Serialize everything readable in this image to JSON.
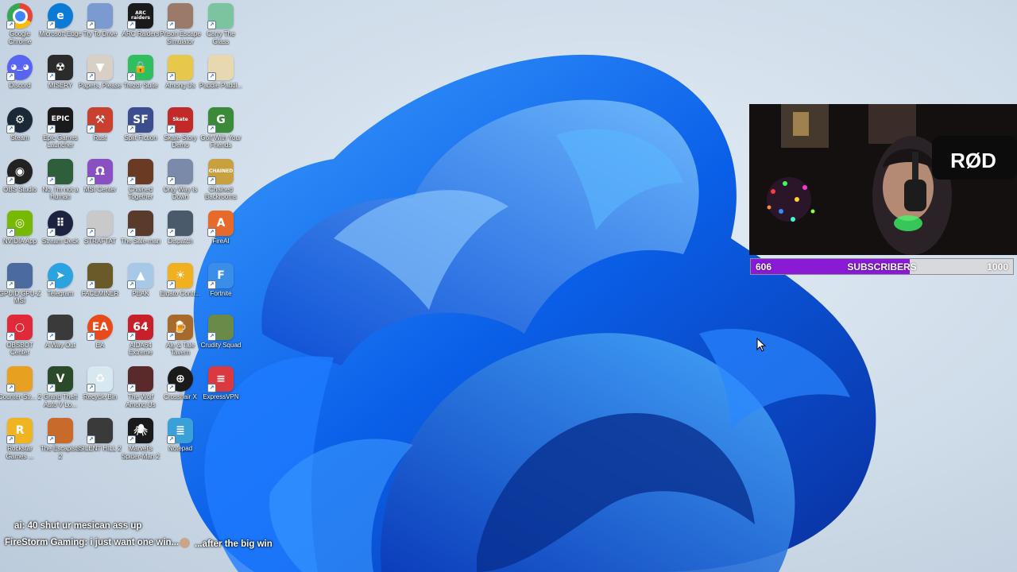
{
  "desktop": {
    "icons": [
      {
        "label": "Google Chrome",
        "color": "#ffffff",
        "glyph": "chrome-icon",
        "text": "",
        "round": true
      },
      {
        "label": "Microsoft Edge",
        "color": "#0c7bd6",
        "glyph": "edge-icon",
        "text": "e",
        "round": true
      },
      {
        "label": "Try To Drive",
        "color": "#7a9ad0",
        "glyph": "game-icon",
        "text": ""
      },
      {
        "label": "ARC Raiders",
        "color": "#1a1a1a",
        "glyph": "arc-raiders-icon",
        "text": "ARC raiders"
      },
      {
        "label": "Prison Escape Simulator",
        "color": "#9b7a6a",
        "glyph": "game-icon",
        "text": ""
      },
      {
        "label": "Carry The Glass",
        "color": "#7cc4a0",
        "glyph": "game-icon",
        "text": ""
      },
      {
        "label": "Discord",
        "color": "#5865f2",
        "glyph": "discord-icon",
        "text": "◕‿◕",
        "round": true
      },
      {
        "label": "MISERY",
        "color": "#2b2b2b",
        "glyph": "misery-icon",
        "text": "☢"
      },
      {
        "label": "Papers, Please",
        "color": "#d8d0c4",
        "glyph": "papers-please-icon",
        "text": "▼"
      },
      {
        "label": "Trezor Suite",
        "color": "#2fbf5f",
        "glyph": "trezor-icon",
        "text": "🔒"
      },
      {
        "label": "Among Us",
        "color": "#e8c84a",
        "glyph": "among-us-icon",
        "text": ""
      },
      {
        "label": "Paddle Paddl...",
        "color": "#e8d8b0",
        "glyph": "game-icon",
        "text": ""
      },
      {
        "label": "Steam",
        "color": "#1b2838",
        "glyph": "steam-icon",
        "text": "⚙",
        "round": true
      },
      {
        "label": "Epic Games Launcher",
        "color": "#1a1a1a",
        "glyph": "epic-games-icon",
        "text": "EPIC"
      },
      {
        "label": "Rust",
        "color": "#c9412e",
        "glyph": "rust-icon",
        "text": "⚒"
      },
      {
        "label": "Split Fiction",
        "color": "#3b4d8f",
        "glyph": "split-fiction-icon",
        "text": "SF"
      },
      {
        "label": "Skate Story Demo",
        "color": "#c22a2a",
        "glyph": "game-icon",
        "text": "Skate"
      },
      {
        "label": "Golf With Your Friends",
        "color": "#3a8a3a",
        "glyph": "golf-icon",
        "text": "G"
      },
      {
        "label": "OBS Studio",
        "color": "#222222",
        "glyph": "obs-icon",
        "text": "◉",
        "round": true
      },
      {
        "label": "No, I'm not a Human",
        "color": "#2e5e3a",
        "glyph": "game-icon",
        "text": ""
      },
      {
        "label": "MSI Center",
        "color": "#8a4fc0",
        "glyph": "msi-center-icon",
        "text": "Ω"
      },
      {
        "label": "Chained Together",
        "color": "#6a3a22",
        "glyph": "game-icon",
        "text": ""
      },
      {
        "label": "Only Way Is Down",
        "color": "#7a8aa8",
        "glyph": "game-icon",
        "text": ""
      },
      {
        "label": "Chained Backrooms",
        "color": "#c8a040",
        "glyph": "game-icon",
        "text": "CHAINED"
      },
      {
        "label": "NVIDIA App",
        "color": "#76b900",
        "glyph": "nvidia-icon",
        "text": "◎"
      },
      {
        "label": "Stream Deck",
        "color": "#1c2240",
        "glyph": "stream-deck-icon",
        "text": "⠿",
        "round": true
      },
      {
        "label": "STRAFTAT",
        "color": "#c9c9c9",
        "glyph": "game-icon",
        "text": ""
      },
      {
        "label": "The Sale-man",
        "color": "#5a3a2a",
        "glyph": "game-icon",
        "text": ""
      },
      {
        "label": "Dispatch",
        "color": "#4a5a6a",
        "glyph": "game-icon",
        "text": ""
      },
      {
        "label": "FireAI",
        "color": "#e86a2a",
        "glyph": "fireai-icon",
        "text": "A"
      },
      {
        "label": "GPUID GPU-Z MSI",
        "color": "#4a6aa0",
        "glyph": "gpuz-icon",
        "text": ""
      },
      {
        "label": "Telegram",
        "color": "#2aa3e0",
        "glyph": "telegram-icon",
        "text": "➤",
        "round": true
      },
      {
        "label": "FACEMINER",
        "color": "#6a5a2a",
        "glyph": "game-icon",
        "text": ""
      },
      {
        "label": "PEAK",
        "color": "#a8c8e8",
        "glyph": "peak-icon",
        "text": "▲"
      },
      {
        "label": "Elgato Contr...",
        "color": "#f0b020",
        "glyph": "elgato-icon",
        "text": "☀"
      },
      {
        "label": "Fortnite",
        "color": "#3a8ee8",
        "glyph": "fortnite-icon",
        "text": "F"
      },
      {
        "label": "OBSBOT Center",
        "color": "#e02a3a",
        "glyph": "obsbot-icon",
        "text": "○"
      },
      {
        "label": "A Way Out",
        "color": "#3a3a3a",
        "glyph": "game-icon",
        "text": ""
      },
      {
        "label": "EA",
        "color": "#e84a1a",
        "glyph": "ea-icon",
        "text": "EA",
        "round": true
      },
      {
        "label": "AIDA64 Extreme",
        "color": "#c8202a",
        "glyph": "aida64-icon",
        "text": "64"
      },
      {
        "label": "Ale & Tale Tavern",
        "color": "#a86a2a",
        "glyph": "game-icon",
        "text": "🍺"
      },
      {
        "label": "Crudity Squad",
        "color": "#6a8a4a",
        "glyph": "game-icon",
        "text": ""
      },
      {
        "label": "Counter-Str... 2",
        "color": "#e8a020",
        "glyph": "counter-strike-icon",
        "text": ""
      },
      {
        "label": "Grand Theft Auto V Lo...",
        "color": "#2a4a2a",
        "glyph": "gta-icon",
        "text": "V"
      },
      {
        "label": "Recycle Bin",
        "color": "#d8e8f0",
        "glyph": "recycle-bin-icon",
        "text": "♻"
      },
      {
        "label": "The Wolf Among Us",
        "color": "#5a2a2a",
        "glyph": "game-icon",
        "text": ""
      },
      {
        "label": "Crosshair X",
        "color": "#1a1a1a",
        "glyph": "crosshair-icon",
        "text": "⊕",
        "round": true
      },
      {
        "label": "ExpressVPN",
        "color": "#da3940",
        "glyph": "expressvpn-icon",
        "text": "≡"
      },
      {
        "label": "Rockstar Games ...",
        "color": "#f0b420",
        "glyph": "rockstar-icon",
        "text": "R"
      },
      {
        "label": "The Escapists 2",
        "color": "#c86a2a",
        "glyph": "game-icon",
        "text": ""
      },
      {
        "label": "SILENT HILL 2",
        "color": "#3a3a3a",
        "glyph": "game-icon",
        "text": ""
      },
      {
        "label": "Marvel's Spider-Man 2",
        "color": "#1a1a1a",
        "glyph": "spiderman-icon",
        "text": "🕷"
      },
      {
        "label": "Notepad",
        "color": "#3aa0d8",
        "glyph": "notepad-icon",
        "text": "≣"
      }
    ]
  },
  "overlay": {
    "webcam": {
      "mic_brand": "RØD"
    },
    "subscriber_goal": {
      "current": "606",
      "label": "SUBSCRIBERS",
      "goal": "1000",
      "progress": 0.606,
      "fill_color": "#8a1ad6"
    },
    "chat": [
      {
        "user": "ai",
        "message": ": 40 shut ur mesican ass up"
      },
      {
        "user": "FireStorm Gaming",
        "message": ": i just want one win..."
      },
      {
        "user": "",
        "message": "...after the big win"
      }
    ]
  },
  "colors": {
    "accent": "#1a6ef0",
    "wallpaper_bg": "#cfdce9"
  }
}
